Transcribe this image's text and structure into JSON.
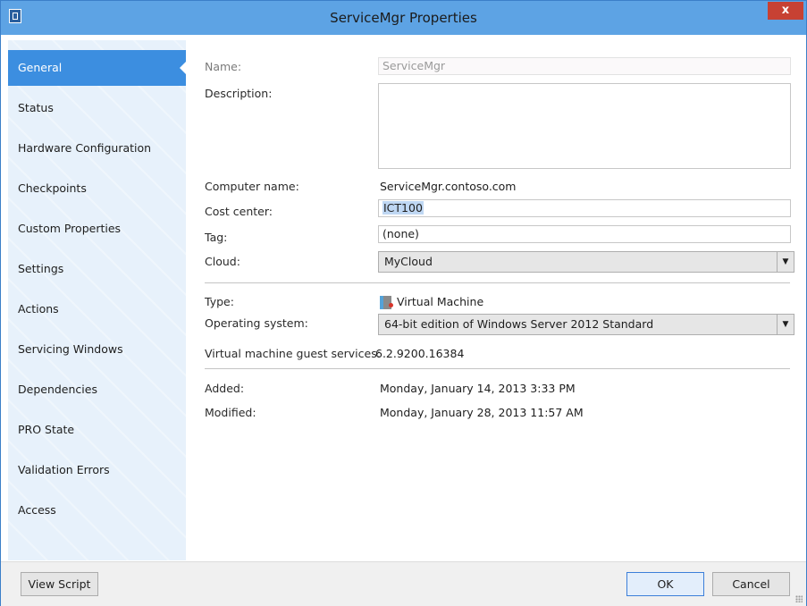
{
  "window": {
    "title": "ServiceMgr Properties",
    "close_label": "x"
  },
  "sidebar": {
    "items": [
      {
        "label": "General"
      },
      {
        "label": "Status"
      },
      {
        "label": "Hardware Configuration"
      },
      {
        "label": "Checkpoints"
      },
      {
        "label": "Custom Properties"
      },
      {
        "label": "Settings"
      },
      {
        "label": "Actions"
      },
      {
        "label": "Servicing Windows"
      },
      {
        "label": "Dependencies"
      },
      {
        "label": "PRO State"
      },
      {
        "label": "Validation Errors"
      },
      {
        "label": "Access"
      }
    ],
    "active_index": 0
  },
  "general": {
    "name_label": "Name:",
    "name_value": "ServiceMgr",
    "description_label": "Description:",
    "description_value": "",
    "computer_name_label": "Computer name:",
    "computer_name_value": "ServiceMgr.contoso.com",
    "cost_center_label": "Cost center:",
    "cost_center_value": "ICT100",
    "tag_label": "Tag:",
    "tag_value": "(none)",
    "cloud_label": "Cloud:",
    "cloud_value": "MyCloud",
    "type_label": "Type:",
    "type_value": "Virtual Machine",
    "type_icon": "virtual-machine-icon",
    "os_label": "Operating system:",
    "os_value": "64-bit edition of Windows Server 2012 Standard",
    "guest_services_label": "Virtual machine guest services:",
    "guest_services_value": "6.2.9200.16384",
    "added_label": "Added:",
    "added_value": "Monday, January 14, 2013 3:33 PM",
    "modified_label": "Modified:",
    "modified_value": "Monday, January 28, 2013 11:57 AM"
  },
  "footer": {
    "view_script_label": "View Script",
    "ok_label": "OK",
    "cancel_label": "Cancel"
  },
  "colors": {
    "titlebar": "#5da3e4",
    "sidebar_bg": "#e7f1fb",
    "active_item": "#3c8ee0",
    "close_button": "#c74133"
  }
}
